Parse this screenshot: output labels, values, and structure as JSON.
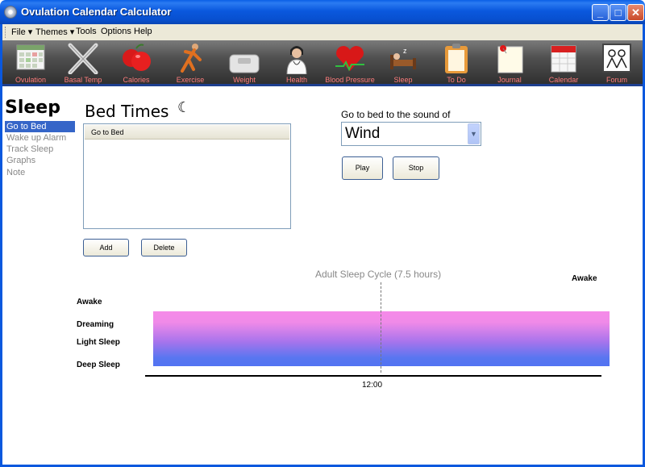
{
  "window": {
    "title": "Ovulation Calendar Calculator",
    "minimize": "_",
    "maximize": "□",
    "close": "✕"
  },
  "menu": [
    "File ▾",
    "Themes ▾",
    "Tools",
    "Options",
    "Help"
  ],
  "toolbar": [
    {
      "label": "Ovulation",
      "icon": "calendar-grid-icon"
    },
    {
      "label": "Basal Temp",
      "icon": "crossed-thermometers-icon"
    },
    {
      "label": "Calories",
      "icon": "apples-icon"
    },
    {
      "label": "Exercise",
      "icon": "exercise-figure-icon"
    },
    {
      "label": "Weight",
      "icon": "scale-icon"
    },
    {
      "label": "Health",
      "icon": "doctor-icon"
    },
    {
      "label": "Blood Pressure",
      "icon": "heart-icon"
    },
    {
      "label": "Sleep",
      "icon": "bed-icon"
    },
    {
      "label": "To Do",
      "icon": "clipboard-icon"
    },
    {
      "label": "Journal",
      "icon": "pinned-note-icon"
    },
    {
      "label": "Calendar",
      "icon": "calendar-page-icon"
    },
    {
      "label": "Forum",
      "icon": "people-board-icon"
    }
  ],
  "sidebar": {
    "title": "Sleep",
    "items": [
      "Go to Bed",
      "Wake up Alarm",
      "Track Sleep",
      "Graphs",
      "Note"
    ],
    "active_index": 0
  },
  "bed_times": {
    "title": "Bed Times",
    "moon": "☾",
    "list_header": "Go to Bed",
    "add_label": "Add",
    "delete_label": "Delete"
  },
  "sound": {
    "label": "Go to bed to the sound of",
    "selected": "Wind",
    "dropdown_arrow": "▼",
    "play_label": "Play",
    "stop_label": "Stop"
  },
  "sleep_chart": {
    "title": "Adult Sleep Cycle (7.5 hours)",
    "end_label": "Awake",
    "stages": [
      "Awake",
      "Dreaming",
      "Light Sleep",
      "Deep Sleep"
    ],
    "time_tick": "12:00"
  },
  "colors": {
    "title_bar": "#0a58de",
    "toolbar_label": "#ff7c7c",
    "active_nav": "#3565c8",
    "band_top": "#f58ae8",
    "band_bottom": "#5273f2"
  }
}
